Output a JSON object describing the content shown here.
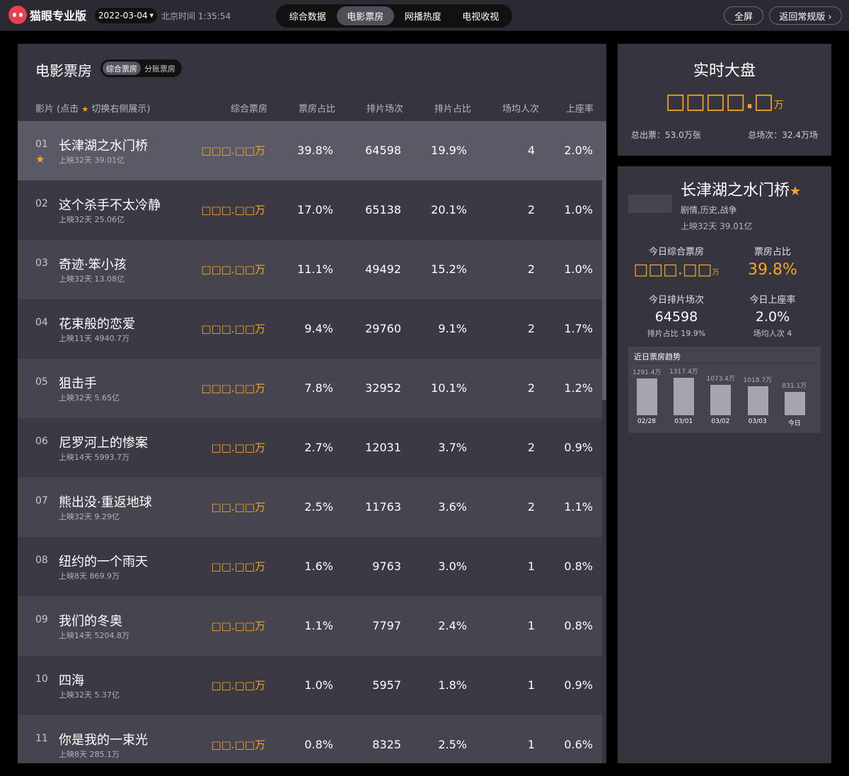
{
  "header": {
    "app_name": "猫眼专业版",
    "date": "2022-03-04",
    "beijing_time": "北京时间 1:35:54",
    "tabs": [
      "综合数据",
      "电影票房",
      "网播热度",
      "电视收视"
    ],
    "active_tab": "电影票房",
    "fullscreen_label": "全屏",
    "back_label": "返回常规版 ›"
  },
  "main": {
    "title": "电影票房",
    "toggle": [
      "综合票房",
      "分账票房"
    ],
    "columns": {
      "film": "影片 (点击",
      "film_suffix": "切换右侧展示)",
      "box_office": "综合票房",
      "bo_share": "票房占比",
      "shows": "排片场次",
      "show_share": "排片占比",
      "avg_people": "场均人次",
      "seat_rate": "上座率"
    },
    "rows": [
      {
        "rank": "01",
        "name": "长津湖之水门桥",
        "sub": "上映32天  39.01亿",
        "bo": "□□□.□□万",
        "bo_share": "39.8%",
        "shows": "64598",
        "show_share": "19.9%",
        "avg": "4",
        "seat": "2.0%"
      },
      {
        "rank": "02",
        "name": "这个杀手不太冷静",
        "sub": "上映32天  25.06亿",
        "bo": "□□□.□□万",
        "bo_share": "17.0%",
        "shows": "65138",
        "show_share": "20.1%",
        "avg": "2",
        "seat": "1.0%"
      },
      {
        "rank": "03",
        "name": "奇迹·笨小孩",
        "sub": "上映32天  13.08亿",
        "bo": "□□□.□□万",
        "bo_share": "11.1%",
        "shows": "49492",
        "show_share": "15.2%",
        "avg": "2",
        "seat": "1.0%"
      },
      {
        "rank": "04",
        "name": "花束般的恋爱",
        "sub": "上映11天  4940.7万",
        "bo": "□□□.□□万",
        "bo_share": "9.4%",
        "shows": "29760",
        "show_share": "9.1%",
        "avg": "2",
        "seat": "1.7%"
      },
      {
        "rank": "05",
        "name": "狙击手",
        "sub": "上映32天  5.65亿",
        "bo": "□□□.□□万",
        "bo_share": "7.8%",
        "shows": "32952",
        "show_share": "10.1%",
        "avg": "2",
        "seat": "1.2%"
      },
      {
        "rank": "06",
        "name": "尼罗河上的惨案",
        "sub": "上映14天  5993.7万",
        "bo": "□□.□□万",
        "bo_share": "2.7%",
        "shows": "12031",
        "show_share": "3.7%",
        "avg": "2",
        "seat": "0.9%"
      },
      {
        "rank": "07",
        "name": "熊出没·重返地球",
        "sub": "上映32天  9.29亿",
        "bo": "□□.□□万",
        "bo_share": "2.5%",
        "shows": "11763",
        "show_share": "3.6%",
        "avg": "2",
        "seat": "1.1%"
      },
      {
        "rank": "08",
        "name": "纽约的一个雨天",
        "sub": "上映8天  869.9万",
        "bo": "□□.□□万",
        "bo_share": "1.6%",
        "shows": "9763",
        "show_share": "3.0%",
        "avg": "1",
        "seat": "0.8%"
      },
      {
        "rank": "09",
        "name": "我们的冬奥",
        "sub": "上映14天  5204.8万",
        "bo": "□□.□□万",
        "bo_share": "1.1%",
        "shows": "7797",
        "show_share": "2.4%",
        "avg": "1",
        "seat": "0.8%"
      },
      {
        "rank": "10",
        "name": "四海",
        "sub": "上映32天  5.37亿",
        "bo": "□□.□□万",
        "bo_share": "1.0%",
        "shows": "5957",
        "show_share": "1.8%",
        "avg": "1",
        "seat": "0.9%"
      },
      {
        "rank": "11",
        "name": "你是我的一束光",
        "sub": "上映8天  285.1万",
        "bo": "□□.□□万",
        "bo_share": "0.8%",
        "shows": "8325",
        "show_share": "2.5%",
        "avg": "1",
        "seat": "0.6%"
      }
    ]
  },
  "realtime": {
    "title": "实时大盘",
    "value": "□□□□.□",
    "unit": "万",
    "tickets": "总出票：53.0万张",
    "shows": "总场次：32.4万场"
  },
  "detail": {
    "name": "长津湖之水门桥",
    "genre": "剧情,历史,战争",
    "release": "上映32天   39.01亿",
    "today_bo_label": "今日综合票房",
    "today_bo_value": "□□□.□□",
    "today_bo_unit": "万",
    "bo_share_label": "票房占比",
    "bo_share_value": "39.8%",
    "shows_label": "今日排片场次",
    "shows_value": "64598",
    "shows_sub": "排片占比 19.9%",
    "seat_label": "今日上座率",
    "seat_value": "2.0%",
    "seat_sub": "场均人次 4",
    "trend_title": "近日票房趋势"
  },
  "chart_data": {
    "type": "bar",
    "title": "近日票房趋势",
    "categories": [
      "02/28",
      "03/01",
      "03/02",
      "03/03",
      "今日"
    ],
    "values": [
      1291.4,
      1317.4,
      1073.4,
      1018.7,
      831.1
    ],
    "labels": [
      "1291.4万",
      "1317.4万",
      "1073.4万",
      "1018.7万",
      "831.1万"
    ]
  },
  "colors": {
    "accent": "#f5a623",
    "brand": "#e8404f",
    "panel": "#35343f"
  }
}
